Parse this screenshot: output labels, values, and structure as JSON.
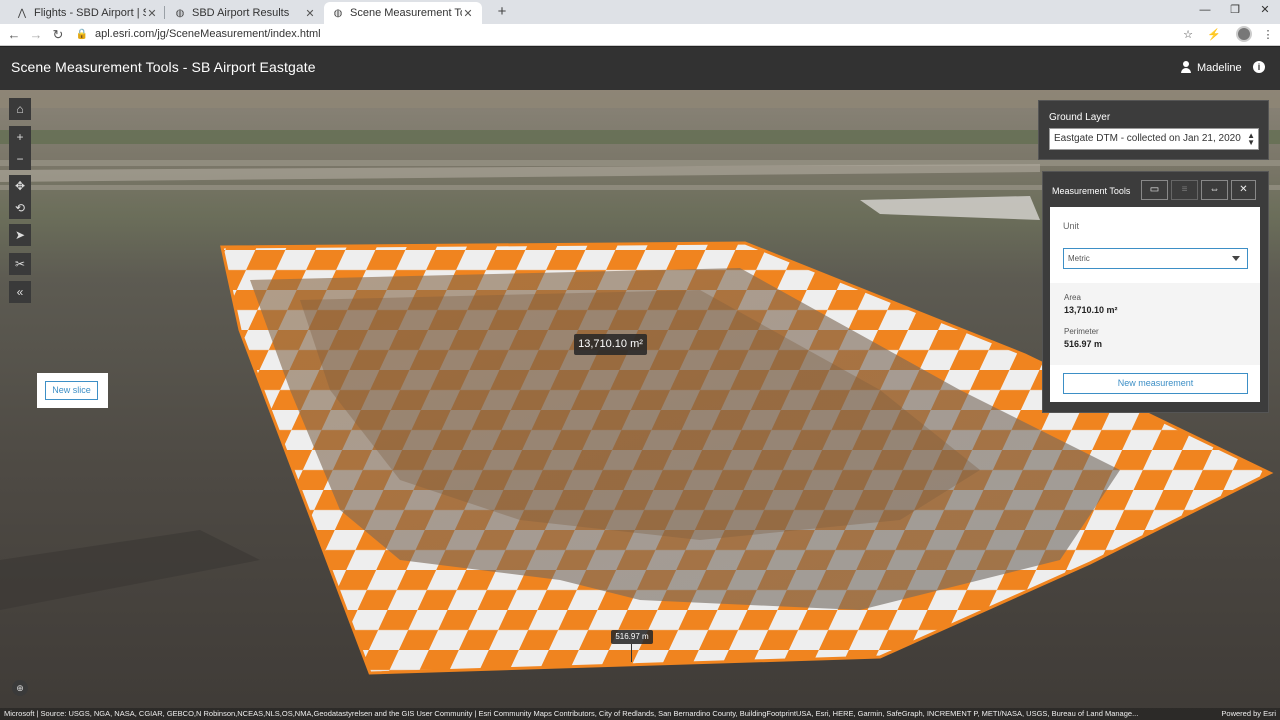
{
  "browser": {
    "tabs": [
      {
        "label": "Flights - SBD Airport | Site Scan",
        "icon": "site-scan-icon"
      },
      {
        "label": "SBD Airport Results",
        "icon": "globe-icon"
      },
      {
        "label": "Scene Measurement Tools - SB A",
        "icon": "globe-icon"
      }
    ],
    "url": "apl.esri.com/jg/SceneMeasurement/index.html"
  },
  "app": {
    "title": "Scene Measurement Tools - SB Airport Eastgate",
    "user": "Madeline"
  },
  "toolbar": {
    "new_slice_label": "New slice"
  },
  "ground_layer": {
    "label": "Ground Layer",
    "selected": "Eastgate DTM - collected on Jan 21, 2020"
  },
  "measurement": {
    "panel_label": "Measurement Tools",
    "unit_label": "Unit",
    "unit_selected": "Metric",
    "area_label": "Area",
    "area_value": "13,710.10 m²",
    "perimeter_label": "Perimeter",
    "perimeter_value": "516.97 m",
    "new_measurement_label": "New measurement"
  },
  "map_labels": {
    "area": "13,710.10 m²",
    "perimeter": "516.97 m"
  },
  "attribution": "Microsoft | Source: USGS, NGA, NASA, CGIAR, GEBCO,N Robinson,NCEAS,NLS,OS,NMA,Geodatastyrelsen and the GIS User Community | Esri Community Maps Contributors, City of Redlands, San Bernardino County, BuildingFootprintUSA, Esri, HERE, Garmin, SafeGraph, INCREMENT P, METI/NASA, USGS, Bureau of Land Manage...",
  "powered_by": "Powered by Esri",
  "colors": {
    "accent": "#3d8fc6",
    "header": "#323232",
    "measure_orange": "#f0841f"
  }
}
